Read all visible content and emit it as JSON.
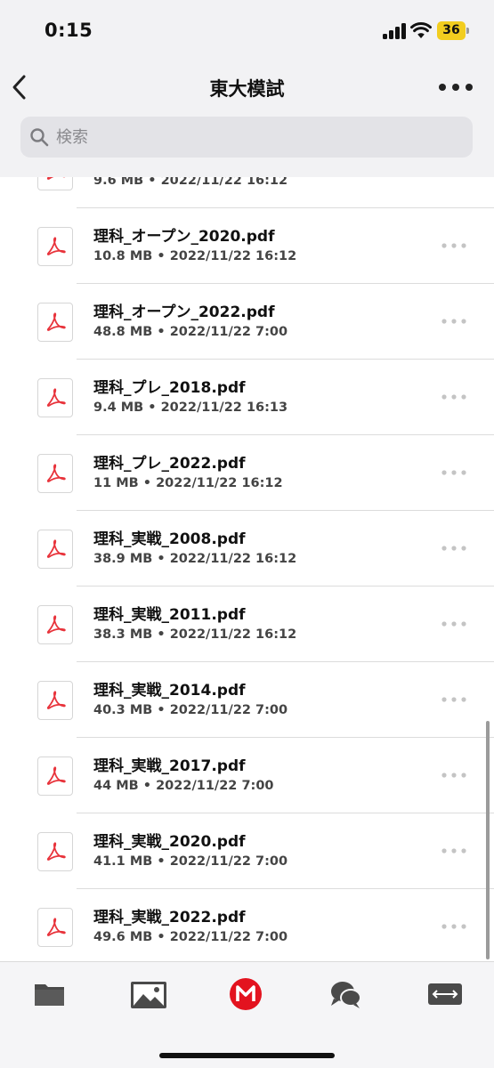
{
  "status_bar": {
    "time": "0:15",
    "battery": "36"
  },
  "nav": {
    "title": "東大模試"
  },
  "search": {
    "placeholder": "検索",
    "value": ""
  },
  "files": [
    {
      "name": "",
      "size": "9.6 MB",
      "date": "2022/11/22 16:12"
    },
    {
      "name": "理科_オープン_2020.pdf",
      "size": "10.8 MB",
      "date": "2022/11/22 16:12"
    },
    {
      "name": "理科_オープン_2022.pdf",
      "size": "48.8 MB",
      "date": "2022/11/22 7:00"
    },
    {
      "name": "理科_プレ_2018.pdf",
      "size": "9.4 MB",
      "date": "2022/11/22 16:13"
    },
    {
      "name": "理科_プレ_2022.pdf",
      "size": "11 MB",
      "date": "2022/11/22 16:12"
    },
    {
      "name": "理科_実戦_2008.pdf",
      "size": "38.9 MB",
      "date": "2022/11/22 16:12"
    },
    {
      "name": "理科_実戦_2011.pdf",
      "size": "38.3 MB",
      "date": "2022/11/22 16:12"
    },
    {
      "name": "理科_実戦_2014.pdf",
      "size": "40.3 MB",
      "date": "2022/11/22 7:00"
    },
    {
      "name": "理科_実戦_2017.pdf",
      "size": "44 MB",
      "date": "2022/11/22 7:00"
    },
    {
      "name": "理科_実戦_2020.pdf",
      "size": "41.1 MB",
      "date": "2022/11/22 7:00"
    },
    {
      "name": "理科_実戦_2022.pdf",
      "size": "49.6 MB",
      "date": "2022/11/22 7:00"
    }
  ],
  "meta_separator": " • ",
  "tabs": [
    {
      "icon": "folder-icon"
    },
    {
      "icon": "photos-icon"
    },
    {
      "icon": "mega-logo-icon"
    },
    {
      "icon": "chat-icon"
    },
    {
      "icon": "transfers-icon"
    }
  ],
  "colors": {
    "pdf_red": "#e8333b",
    "mega_red": "#e3131f",
    "icon_gray": "#4a4a4a"
  }
}
